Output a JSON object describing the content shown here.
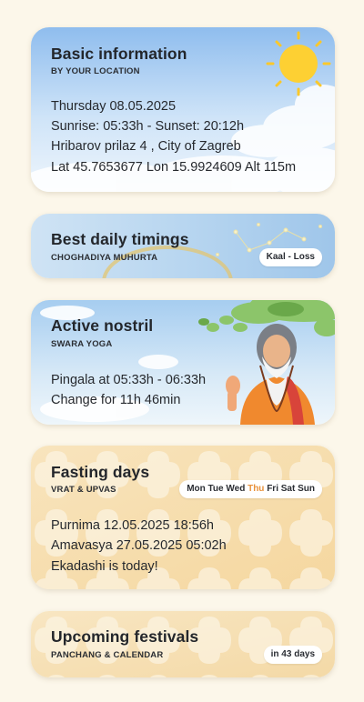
{
  "basic_info": {
    "title": "Basic information",
    "subtitle": "BY YOUR LOCATION",
    "date": "Thursday 08.05.2025",
    "sun": "Sunrise: 05:33h - Sunset: 20:12h",
    "address": "Hribarov prilaz 4 , City of Zagreb",
    "coords": "Lat 45.7653677 Lon 15.9924609 Alt 115m"
  },
  "timings": {
    "title": "Best daily timings",
    "subtitle": "CHOGHADIYA MUHURTA",
    "badge": "Kaal - Loss"
  },
  "nostril": {
    "title": "Active nostril",
    "subtitle": "SWARA YOGA",
    "line1": "Pingala at 05:33h - 06:33h",
    "line2": "Change for 11h 46min"
  },
  "fasting": {
    "title": "Fasting days",
    "subtitle": "VRAT & UPVAS",
    "days": [
      "Mon",
      "Tue",
      "Wed",
      "Thu",
      "Fri",
      "Sat",
      "Sun"
    ],
    "active_day": "Thu",
    "line1": "Purnima 12.05.2025 18:56h",
    "line2": "Amavasya 27.05.2025 05:02h",
    "line3": "Ekadashi is today!"
  },
  "festivals": {
    "title": "Upcoming festivals",
    "subtitle": "PANCHANG & CALENDAR",
    "badge": "in 43 days"
  },
  "colors": {
    "page_bg": "#fcf7ea",
    "sky_top": "#9cc6ef",
    "accent_day": "#e8913a",
    "fasting_bg": "#f7dfb0"
  }
}
